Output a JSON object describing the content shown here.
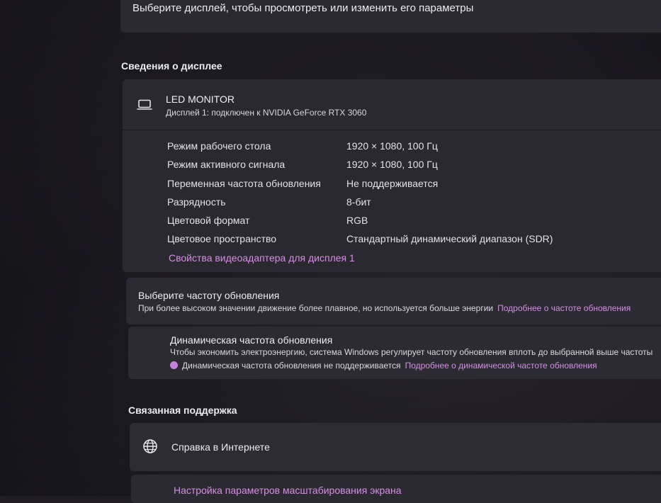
{
  "top": {
    "prompt_text": "Выберите дисплей, чтобы просмотреть или изменить его параметры"
  },
  "display_info": {
    "section_title": "Сведения о дисплее",
    "monitor_name": "LED MONITOR",
    "monitor_subtitle": "Дисплей 1: подключен к NVIDIA GeForce RTX 3060",
    "icon": "laptop-icon",
    "properties": [
      {
        "label": "Режим рабочего стола",
        "value": "1920 × 1080, 100 Гц"
      },
      {
        "label": "Режим активного сигнала",
        "value": "1920 × 1080, 100 Гц"
      },
      {
        "label": "Переменная частота обновления",
        "value": "Не поддерживается"
      },
      {
        "label": "Разрядность",
        "value": "8-бит"
      },
      {
        "label": "Цветовой формат",
        "value": "RGB"
      },
      {
        "label": "Цветовое пространство",
        "value": "Стандартный динамический диапазон (SDR)"
      }
    ],
    "adapter_link": "Свойства видеоадаптера для дисплея 1"
  },
  "refresh_rate": {
    "title": "Выберите частоту обновления",
    "description": "При более высоком значении движение более плавное, но используется больше энергии",
    "learn_more_link": "Подробнее о частоте обновления"
  },
  "dynamic_refresh": {
    "title": "Динамическая частота обновления",
    "description": "Чтобы экономить электроэнергию, система Windows регулирует частоту обновления вплоть до выбранной выше частоты",
    "warning_text": "Динамическая частота обновления не поддерживается",
    "learn_more_link": "Подробнее о динамической частоте обновления"
  },
  "related_support": {
    "section_title": "Связанная поддержка",
    "help_item": {
      "icon": "globe-icon",
      "label": "Справка в Интернете"
    },
    "scaling_link": "Настройка параметров масштабирования экрана"
  },
  "colors": {
    "accent_link": "#d58ee6",
    "card": "#2b2a30",
    "background": "#1e1c23"
  }
}
